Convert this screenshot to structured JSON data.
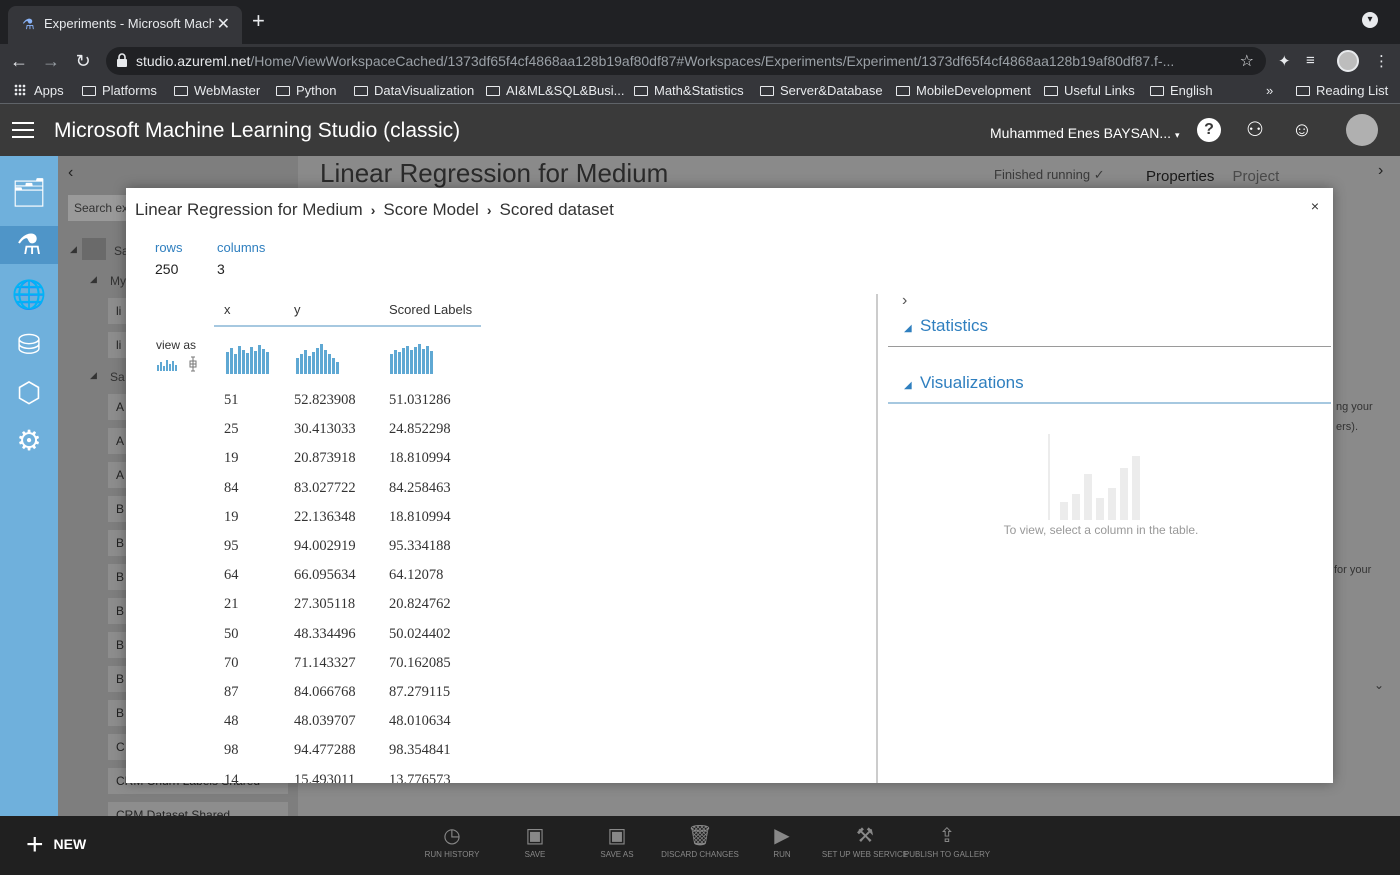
{
  "browser": {
    "tab_title": "Experiments - Microsoft Machi",
    "url_host": "studio.azureml.net",
    "url_path": "/Home/ViewWorkspaceCached/1373df65f4cf4868aa128b19af80df87#Workspaces/Experiments/Experiment/1373df65f4cf4868aa128b19af80df87.f-...",
    "bookmarks": [
      "Apps",
      "Platforms",
      "WebMaster",
      "Python",
      "DataVisualization",
      "AI&ML&SQL&Busi...",
      "Math&Statistics",
      "Server&Database",
      "MobileDevelopment",
      "Useful Links",
      "English"
    ],
    "more_bookmarks": "»",
    "reading_list": "Reading List"
  },
  "app": {
    "title": "Microsoft Machine Learning Studio (classic)",
    "user_name": "Muhammed Enes BAYSAN...",
    "help": "?"
  },
  "background": {
    "experiment_title": "Linear Regression for Medium",
    "status": "Finished running",
    "search_placeholder": "Search ex",
    "panel_tabs": [
      "Properties",
      "Project"
    ],
    "palette_items": [
      "Sa",
      "My",
      "li",
      "li",
      "Sa",
      "A",
      "A",
      "A",
      "B",
      "B",
      "B",
      "B",
      "B",
      "B",
      "B",
      "C",
      "CRM Churn Labels Shared",
      "CRM Dataset Shared"
    ],
    "side_text_1": "ng your",
    "side_text_2": "ers).",
    "side_text_3": "for your"
  },
  "commands": {
    "new_label": "NEW",
    "items": [
      "RUN HISTORY",
      "SAVE",
      "SAVE AS",
      "DISCARD CHANGES",
      "RUN",
      "SET UP WEB SERVICE",
      "PUBLISH TO GALLERY"
    ]
  },
  "modal": {
    "breadcrumb": [
      "Linear Regression for Medium",
      "Score Model",
      "Scored dataset"
    ],
    "close": "×",
    "rows_label": "rows",
    "rows_value": "250",
    "columns_label": "columns",
    "columns_value": "3",
    "view_as_label": "view as",
    "columns": [
      "x",
      "y",
      "Scored Labels"
    ],
    "rows": [
      [
        "51",
        "52.823908",
        "51.031286"
      ],
      [
        "25",
        "30.413033",
        "24.852298"
      ],
      [
        "19",
        "20.873918",
        "18.810994"
      ],
      [
        "84",
        "83.027722",
        "84.258463"
      ],
      [
        "19",
        "22.136348",
        "18.810994"
      ],
      [
        "95",
        "94.002919",
        "95.334188"
      ],
      [
        "64",
        "66.095634",
        "64.12078"
      ],
      [
        "21",
        "27.305118",
        "20.824762"
      ],
      [
        "50",
        "48.334496",
        "50.024402"
      ],
      [
        "70",
        "71.143327",
        "70.162085"
      ],
      [
        "87",
        "84.066768",
        "87.279115"
      ],
      [
        "48",
        "48.039707",
        "48.010634"
      ],
      [
        "98",
        "94.477288",
        "98.354841"
      ],
      [
        "14",
        "15.493011",
        "13.776573"
      ]
    ],
    "statistics_title": "Statistics",
    "visualizations_title": "Visualizations",
    "viz_hint": "To view, select a column in the table.",
    "colors": {
      "accent": "#2f7fbf",
      "histogram": "#5fa8d3",
      "rail": "#6fb0dc"
    }
  }
}
